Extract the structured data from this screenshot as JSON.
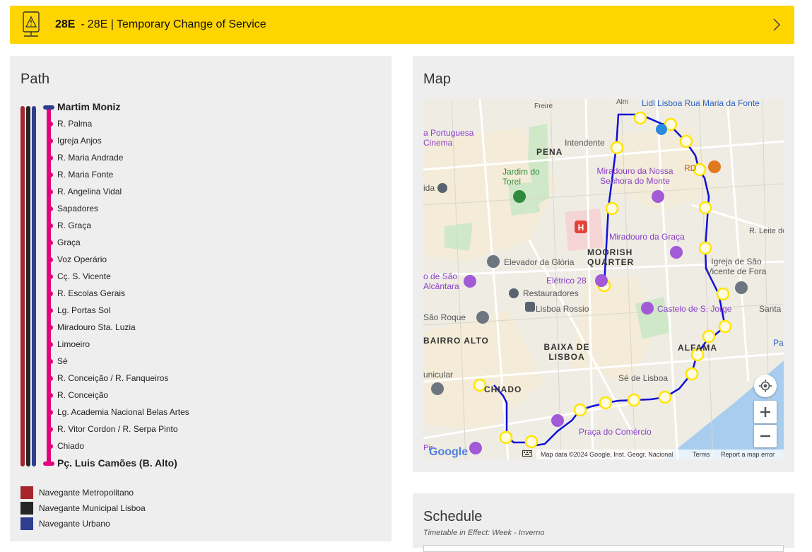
{
  "alert": {
    "route": "28E",
    "separator": "-",
    "title": "28E | Temporary Change of Service",
    "icon": "warning-sign-icon"
  },
  "path": {
    "heading": "Path",
    "stops": [
      "Martim Moniz",
      "R. Palma",
      "Igreja Anjos",
      "R. Maria Andrade",
      "R. Maria Fonte",
      "R. Angelina Vidal",
      "Sapadores",
      "R. Graça",
      "Graça",
      "Voz Operário",
      "Cç. S. Vicente",
      "R. Escolas Gerais",
      "Lg. Portas Sol",
      "Miradouro Sta. Luzia",
      "Limoeiro",
      "Sé",
      "R. Conceição / R. Fanqueiros",
      "R. Conceição",
      "Lg. Academia Nacional Belas Artes",
      "R. Vitor Cordon / R. Serpa Pinto",
      "Chiado",
      "Pç. Luis Camões (B. Alto)"
    ],
    "legend": [
      {
        "label": "Navegante Metropolitano",
        "color": "#a6262b"
      },
      {
        "label": "Navegante Municipal Lisboa",
        "color": "#262626"
      },
      {
        "label": "Navegante Urbano",
        "color": "#2e3f8f"
      }
    ],
    "line_color": "#e5007d"
  },
  "map": {
    "heading": "Map",
    "labels": {
      "lidl": "Lidl Lisboa Rua Maria da Fonte",
      "portuguesa": "a Portuguesa Cinema",
      "pena": "PENA",
      "intendente": "Intendente",
      "jardim": "Jardim do Torel",
      "miradouro_monte": "Miradouro da Nossa Senhora do Monte",
      "rd": "RD",
      "ida": "ida",
      "leite": "R. Leite de V",
      "miradouro_graca": "Miradouro da Graça",
      "moorish": "MOORISH QUARTER",
      "elevador": "Elevador da Glória",
      "igreja_vicente": "Igreja de São Vicente de Fora",
      "electrico": "Elétrico 28",
      "sao_alcantara": "o de São Alcântara",
      "restauradores": "Restauradores",
      "rossio": "Lisboa Rossio",
      "castelo": "Castelo de S. Jorge",
      "santa": "Santa",
      "sao_roque": "São Roque",
      "bairro_alto": "BAIRRO ALTO",
      "baixa": "BAIXA DE LISBOA",
      "alfama": "ALFAMA",
      "pa": "Pa",
      "unicular": "unicular",
      "chiado": "CHIADO",
      "se_lisboa": "Sé de Lisboa",
      "comercio": "Praça do Comércio",
      "alm": "Alm",
      "freire": "Freire",
      "pir": "Pir"
    },
    "footer": {
      "logo": "Google",
      "attribution": "Map data ©2024 Google, Inst. Geogr. Nacional",
      "terms": "Terms",
      "report": "Report a map error"
    },
    "route_color": "#1010d8",
    "stop_color": "#ffe500"
  },
  "schedule": {
    "heading": "Schedule",
    "subtitle": "Timetable in Effect: Week - Inverno"
  }
}
